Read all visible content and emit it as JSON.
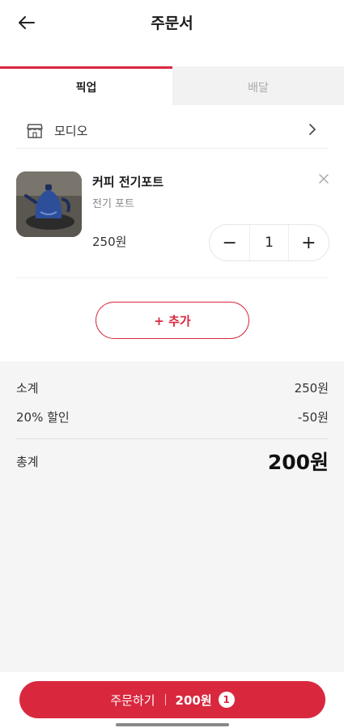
{
  "header": {
    "title": "주문서",
    "back_icon": "arrow-left-icon"
  },
  "tabs": [
    {
      "label": "픽업",
      "active": true
    },
    {
      "label": "배달",
      "active": false
    }
  ],
  "store": {
    "name": "모디오",
    "icon": "store-icon"
  },
  "cart_item": {
    "name": "커피 전기포트",
    "description": "전기 포트",
    "price": "250원",
    "quantity": "1",
    "decrement_symbol": "−",
    "increment_symbol": "+"
  },
  "add_button": {
    "label": "+ 추가"
  },
  "summary": {
    "subtotal_label": "소계",
    "subtotal_value": "250원",
    "discount_label": "20% 할인",
    "discount_value": "-50원",
    "total_label": "총계",
    "total_value": "200원"
  },
  "order_button": {
    "label": "주문하기",
    "amount": "200원",
    "badge": "1"
  },
  "colors": {
    "accent": "#d9283e",
    "summary_bg": "#f5f5f5",
    "inactive_tab_bg": "#f2f2f2"
  }
}
